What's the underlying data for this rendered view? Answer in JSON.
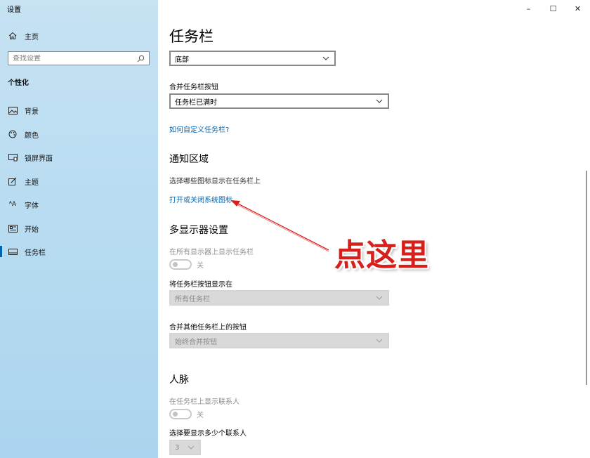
{
  "window": {
    "title": "设置",
    "controls": {
      "minimize": "–",
      "maximize": "☐",
      "close": "✕"
    }
  },
  "sidebar": {
    "home": "主页",
    "search_placeholder": "查找设置",
    "section": "个性化",
    "items": [
      {
        "label": "背景",
        "icon": "image-icon"
      },
      {
        "label": "颜色",
        "icon": "palette-icon"
      },
      {
        "label": "锁屏界面",
        "icon": "lock-screen-icon"
      },
      {
        "label": "主题",
        "icon": "theme-brush-icon"
      },
      {
        "label": "字体",
        "icon": "font-icon"
      },
      {
        "label": "开始",
        "icon": "start-icon"
      },
      {
        "label": "任务栏",
        "icon": "taskbar-icon",
        "active": true
      }
    ]
  },
  "main": {
    "title": "任务栏",
    "position_select": "底部",
    "combine_label": "合并任务栏按钮",
    "combine_select": "任务栏已满时",
    "customize_link": "如何自定义任务栏?",
    "notification": {
      "heading": "通知区域",
      "select_icons_link": "选择哪些图标显示在任务栏上",
      "system_icons_link": "打开或关闭系统图标"
    },
    "multi_display": {
      "heading": "多显示器设置",
      "show_all_label": "在所有显示器上显示任务栏",
      "show_all_state": "关",
      "buttons_on_label": "将任务栏按钮显示在",
      "buttons_on_select": "所有任务栏",
      "combine_other_label": "合并其他任务栏上的按钮",
      "combine_other_select": "始终合并按钮"
    },
    "people": {
      "heading": "人脉",
      "show_contacts_label": "在任务栏上显示联系人",
      "show_contacts_state": "关",
      "count_label": "选择要显示多少个联系人",
      "count_select": "3"
    }
  },
  "annotation": {
    "text": "点这里",
    "color": "#d5201c"
  },
  "colors": {
    "accent": "#0063b1",
    "link": "#0066b4",
    "sidebar_bg": "#b9dcf1"
  }
}
